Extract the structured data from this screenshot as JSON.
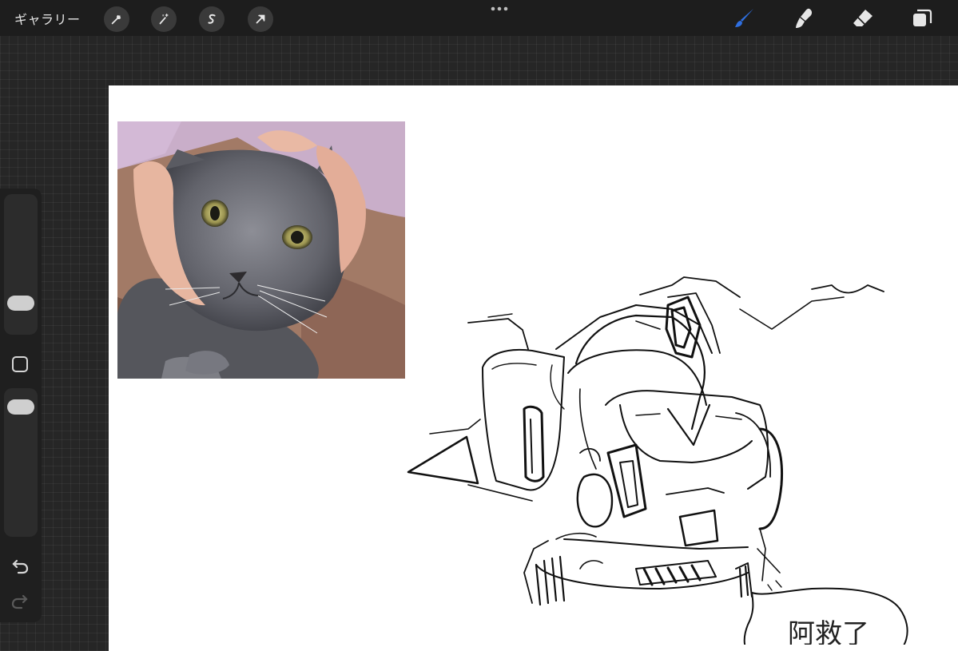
{
  "topbar": {
    "gallery_label": "ギャラリー",
    "left_tools": [
      "wrench-icon",
      "magic-wand-icon",
      "selection-icon",
      "transform-arrow-icon"
    ],
    "right_tools": [
      "brush-icon",
      "smudge-icon",
      "eraser-icon",
      "layers-icon"
    ]
  },
  "sketch": {
    "speech_text": "阿救了"
  },
  "sidebar": {
    "items": [
      "brush-size-slider",
      "modify-button",
      "opacity-slider",
      "undo-icon",
      "redo-icon"
    ]
  },
  "colors": {
    "accent": "#2f6fe0",
    "topbar_bg": "#1d1d1d",
    "canvas_bg": "#ffffff"
  }
}
